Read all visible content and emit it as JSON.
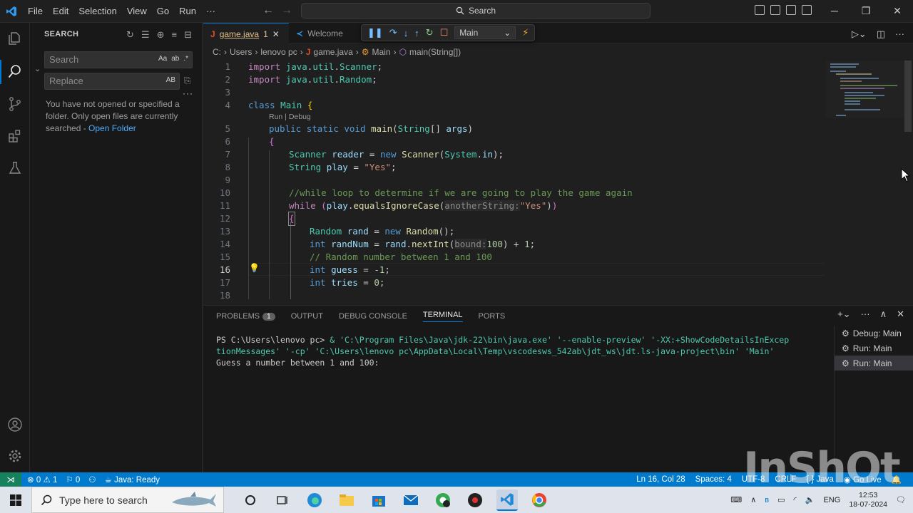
{
  "titlebar": {
    "menu": [
      "File",
      "Edit",
      "Selection",
      "View",
      "Go",
      "Run",
      "···"
    ],
    "search_label": "Search"
  },
  "sidebar": {
    "title": "SEARCH",
    "search_placeholder": "Search",
    "search_options": [
      "Aa",
      "ab",
      ".*"
    ],
    "replace_placeholder": "Replace",
    "replace_option": "AB",
    "more": "···",
    "message": "You have not opened or specified a folder. Only open files are currently searched - ",
    "open_folder_link": "Open Folder"
  },
  "tabs": {
    "active": {
      "label": "game.java",
      "badge": "1"
    },
    "inactive": {
      "label": "Welcome"
    }
  },
  "debug_toolbar": {
    "config": "Main"
  },
  "breadcrumb": [
    "C:",
    "Users",
    "lenovo pc",
    "game.java",
    "Main",
    "main(String[])"
  ],
  "code": {
    "line_numbers": [
      "1",
      "2",
      "3",
      "4",
      "5",
      "6",
      "7",
      "8",
      "9",
      "10",
      "11",
      "12",
      "13",
      "14",
      "15",
      "16",
      "17",
      "18"
    ],
    "codelens": "Run | Debug",
    "current_line": "16",
    "hint_another": "anotherString:",
    "hint_bound": "bound:"
  },
  "panel": {
    "tabs": [
      "PROBLEMS",
      "OUTPUT",
      "DEBUG CONSOLE",
      "TERMINAL",
      "PORTS"
    ],
    "problems_count": "1",
    "terminal_line1_prompt": "PS C:\\Users\\lenovo pc> ",
    "terminal_line1_cmd": " & 'C:\\Program Files\\Java\\jdk-22\\bin\\java.exe' '--enable-preview' '-XX:+ShowCodeDetailsInExcep",
    "terminal_line2": "tionMessages' '-cp' 'C:\\Users\\lenovo pc\\AppData\\Local\\Temp\\vscodesws_542ab\\jdt_ws\\jdt.ls-java-project\\bin' 'Main'",
    "terminal_line3": "Guess a number between 1 and 100:",
    "terminals": [
      "Debug: Main",
      "Run: Main",
      "Run: Main"
    ]
  },
  "statusbar": {
    "errors": "0",
    "warnings": "1",
    "ports": "0",
    "java_status": "Java: Ready",
    "position": "Ln 16, Col 28",
    "spaces": "Spaces: 4",
    "encoding": "UTF-8",
    "eol": "CRLF",
    "language": "{ } Java",
    "golive": "Go Live"
  },
  "watermark": "InShOt",
  "taskbar": {
    "search_placeholder": "Type here to search",
    "lang": "ENG",
    "time": "12:53",
    "date": "18-07-2024"
  },
  "colors": {
    "accent": "#0078d4",
    "statusbar": "#007acc",
    "editor_bg": "#1f1f1f",
    "sidebar_bg": "#181818"
  }
}
